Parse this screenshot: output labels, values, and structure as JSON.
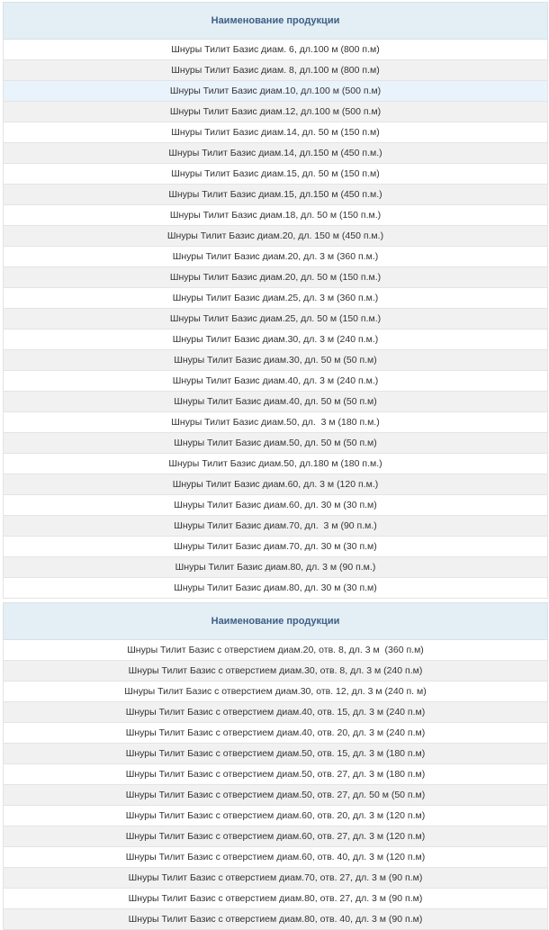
{
  "table1": {
    "header": "Наименование продукции",
    "highlight_index": 2,
    "rows": [
      "Шнуры Тилит Базис диам. 6, дл.100 м (800 п.м)",
      "Шнуры Тилит Базис диам. 8, дл.100 м (800 п.м)",
      "Шнуры Тилит Базис диам.10, дл.100 м (500 п.м)",
      "Шнуры Тилит Базис диам.12, дл.100 м (500 п.м)",
      "Шнуры Тилит Базис диам.14, дл. 50 м (150 п.м)",
      "Шнуры Тилит Базис диам.14, дл.150 м (450 п.м.)",
      "Шнуры Тилит Базис диам.15, дл. 50 м (150 п.м)",
      "Шнуры Тилит Базис диам.15, дл.150 м (450 п.м.)",
      "Шнуры Тилит Базис диам.18, дл. 50 м (150 п.м.)",
      "Шнуры Тилит Базис диам.20, дл. 150 м (450 п.м.)",
      "Шнуры Тилит Базис диам.20, дл. 3 м (360 п.м.)",
      "Шнуры Тилит Базис диам.20, дл. 50 м (150 п.м.)",
      "Шнуры Тилит Базис диам.25, дл. 3 м (360 п.м.)",
      "Шнуры Тилит Базис диам.25, дл. 50 м (150 п.м.)",
      "Шнуры Тилит Базис диам.30, дл. 3 м (240 п.м.)",
      "Шнуры Тилит Базис диам.30, дл. 50 м (50 п.м)",
      "Шнуры Тилит Базис диам.40, дл. 3 м (240 п.м.)",
      "Шнуры Тилит Базис диам.40, дл. 50 м (50 п.м)",
      "Шнуры Тилит Базис диам.50, дл.  3 м (180 п.м.)",
      "Шнуры Тилит Базис диам.50, дл. 50 м (50 п.м)",
      "Шнуры Тилит Базис диам.50, дл.180 м (180 п.м.)",
      "Шнуры Тилит Базис диам.60, дл. 3 м (120 п.м.)",
      "Шнуры Тилит Базис диам.60, дл. 30 м (30 п.м)",
      "Шнуры Тилит Базис диам.70, дл.  3 м (90 п.м.)",
      "Шнуры Тилит Базис диам.70, дл. 30 м (30 п.м)",
      "Шнуры Тилит Базис диам.80, дл. 3 м (90 п.м.)",
      "Шнуры Тилит Базис диам.80, дл. 30 м (30 п.м)"
    ]
  },
  "table2": {
    "header": "Наименование продукции",
    "rows": [
      "Шнуры Тилит Базис с отверстием диам.20, отв. 8, дл. 3 м  (360 п.м)",
      "Шнуры Тилит Базис с отверстием диам.30, отв. 8, дл. 3 м (240 п.м)",
      "Шнуры Тилит Базис с отверстием диам.30, отв. 12, дл. 3 м (240 п. м)",
      "Шнуры Тилит Базис с отверстием диам.40, отв. 15, дл. 3 м (240 п.м)",
      "Шнуры Тилит Базис с отверстием диам.40, отв. 20, дл. 3 м (240 п.м)",
      "Шнуры Тилит Базис с отверстием диам.50, отв. 15, дл. 3 м (180 п.м)",
      "Шнуры Тилит Базис с отверстием диам.50, отв. 27, дл. 3 м (180 п.м)",
      "Шнуры Тилит Базис с отверстием диам.50, отв. 27, дл. 50 м (50 п.м)",
      "Шнуры Тилит Базис с отверстием диам.60, отв. 20, дл. 3 м (120 п.м)",
      "Шнуры Тилит Базис с отверстием диам.60, отв. 27, дл. 3 м (120 п.м)",
      "Шнуры Тилит Базис с отверстием диам.60, отв. 40, дл. 3 м (120 п.м)",
      "Шнуры Тилит Базис с отверстием диам.70, отв. 27, дл. 3 м (90 п.м)",
      "Шнуры Тилит Базис с отверстием диам.80, отв. 27, дл. 3 м (90 п.м)",
      "Шнуры Тилит Базис с отверстием диам.80, отв. 40, дл. 3 м (90 п.м)"
    ]
  },
  "colors": {
    "header_bg": "#e3eef5",
    "header_text": "#3d5f86",
    "row_odd": "#ffffff",
    "row_even": "#f1f1f1",
    "row_highlight": "#e9f3fb",
    "cell_text": "#333333"
  }
}
